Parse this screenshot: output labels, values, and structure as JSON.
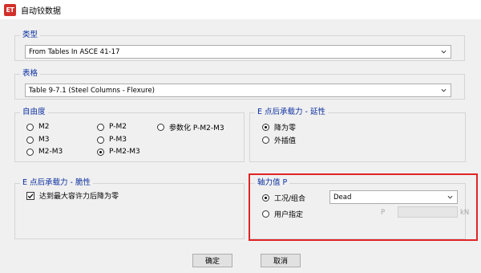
{
  "window": {
    "title": "自动铰数据",
    "icon_text": "ET"
  },
  "type_group": {
    "label": "类型",
    "value": "From Tables In ASCE 41-17"
  },
  "table_group": {
    "label": "表格",
    "value": "Table 9-7.1 (Steel Columns - Flexure)"
  },
  "dof_group": {
    "label": "自由度",
    "options": [
      {
        "label": "M2",
        "checked": false
      },
      {
        "label": "M3",
        "checked": false
      },
      {
        "label": "M2-M3",
        "checked": false
      },
      {
        "label": "P-M2",
        "checked": false
      },
      {
        "label": "P-M3",
        "checked": false
      },
      {
        "label": "P-M2-M3",
        "checked": true
      },
      {
        "label": "参数化 P-M2-M3",
        "checked": false
      }
    ]
  },
  "ductile_group": {
    "label": "E 点后承载力 - 延性",
    "options": [
      {
        "label": "降为零",
        "checked": true
      },
      {
        "label": "外插值",
        "checked": false
      }
    ]
  },
  "brittle_group": {
    "label": "E 点后承载力 - 脆性",
    "checkbox_label": "达到最大容许力后降为零",
    "checked": true
  },
  "axial_group": {
    "label": "轴力值 P",
    "options": [
      {
        "label": "工况/组合",
        "checked": true
      },
      {
        "label": "用户指定",
        "checked": false
      }
    ],
    "case_value": "Dead",
    "p_label": "P",
    "unit_label": "kN"
  },
  "buttons": {
    "ok": "确定",
    "cancel": "取消"
  },
  "colors": {
    "group_label": "#0b2fa0",
    "highlight": "#e02424",
    "app_icon": "#d1302b"
  }
}
